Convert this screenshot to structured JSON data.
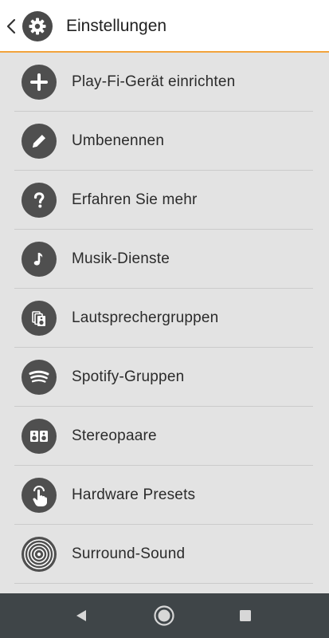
{
  "header": {
    "title": "Einstellungen",
    "icon": "gear-icon",
    "accent_color": "#f2a33c"
  },
  "menu": [
    {
      "label": "Play-Fi-Gerät einrichten",
      "icon": "plus-icon"
    },
    {
      "label": "Umbenennen",
      "icon": "pencil-icon"
    },
    {
      "label": "Erfahren Sie mehr",
      "icon": "question-icon"
    },
    {
      "label": "Musik-Dienste",
      "icon": "music-note-icon"
    },
    {
      "label": "Lautsprechergruppen",
      "icon": "speaker-group-icon"
    },
    {
      "label": "Spotify-Gruppen",
      "icon": "spotify-icon"
    },
    {
      "label": "Stereopaare",
      "icon": "stereo-pair-icon"
    },
    {
      "label": "Hardware Presets",
      "icon": "touch-hand-icon"
    },
    {
      "label": "Surround-Sound",
      "icon": "surround-icon"
    }
  ],
  "navbar": {
    "buttons": [
      "back-nav-icon",
      "home-nav-icon",
      "recents-nav-icon"
    ]
  }
}
